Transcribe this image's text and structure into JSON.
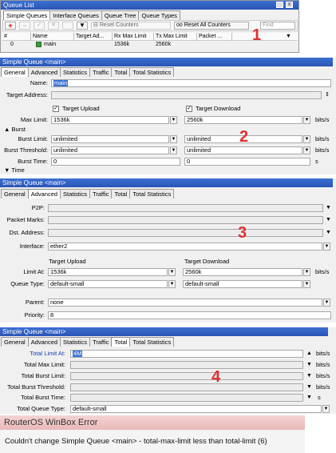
{
  "queue_list": {
    "title": "Queue List",
    "tabs": [
      "Simple Queues",
      "Interface Queues",
      "Queue Tree",
      "Queue Types"
    ],
    "toolbar": {
      "reset_counters": "Reset Counters",
      "reset_all_counters": "Reset All Counters",
      "find_placeholder": "Find"
    },
    "columns": [
      "#",
      "Name",
      "Target Ad...",
      "Rx Max Limit",
      "Tx Max Limit",
      "Packet ..."
    ],
    "rows": [
      {
        "num": "0",
        "name": "main",
        "target": "",
        "rx": "1536k",
        "tx": "2560k",
        "packet": ""
      }
    ],
    "annotation": "1"
  },
  "general_window": {
    "title": "Simple Queue <main>",
    "tabs": [
      "General",
      "Advanced",
      "Statistics",
      "Traffic",
      "Total",
      "Total Statistics"
    ],
    "name_label": "Name:",
    "name_value": "main",
    "target_address_label": "Target Address:",
    "target_upload_label": "Target Upload",
    "target_download_label": "Target Download",
    "max_limit_label": "Max Limit:",
    "max_limit_up": "1536k",
    "max_limit_down": "2560k",
    "burst_section": "Burst",
    "burst_limit_label": "Burst Limit:",
    "burst_limit_up": "unlimited",
    "burst_limit_down": "unlimited",
    "burst_threshold_label": "Burst Threshold:",
    "burst_threshold_up": "unlimited",
    "burst_threshold_down": "unlimited",
    "burst_time_label": "Burst Time:",
    "burst_time_up": "0",
    "burst_time_down": "0",
    "time_section": "Time",
    "unit_bits": "bits/s",
    "unit_s": "s",
    "annotation": "2"
  },
  "advanced_window": {
    "title": "Simple Queue <main>",
    "tabs": [
      "General",
      "Advanced",
      "Statistics",
      "Traffic",
      "Total",
      "Total Statistics"
    ],
    "p2p_label": "P2P:",
    "packet_marks_label": "Packet Marks:",
    "dst_address_label": "Dst. Address:",
    "interface_label": "Interface:",
    "interface_value": "ether2",
    "target_upload_label": "Target Upload",
    "target_download_label": "Target Download",
    "limit_at_label": "Limit At:",
    "limit_at_up": "1536k",
    "limit_at_down": "2560k",
    "queue_type_label": "Queue Type:",
    "queue_type_up": "default-small",
    "queue_type_down": "default-small",
    "parent_label": "Parent:",
    "parent_value": "none",
    "priority_label": "Priority:",
    "priority_value": "8",
    "unit_bits": "bits/s",
    "annotation": "3"
  },
  "total_window": {
    "title": "Simple Queue <main>",
    "tabs": [
      "General",
      "Advanced",
      "Statistics",
      "Traffic",
      "Total",
      "Total Statistics"
    ],
    "total_limit_at_label": "Total Limit At:",
    "total_limit_at_value": "4M",
    "total_max_limit_label": "Total Max Limit:",
    "total_burst_limit_label": "Total Burst Limit:",
    "total_burst_threshold_label": "Total Burst Threshold:",
    "total_burst_time_label": "Total Burst Time:",
    "total_queue_type_label": "Total Queue Type:",
    "total_queue_type_value": "default-small",
    "unit_bits": "bits/s",
    "unit_s": "s",
    "annotation": "4"
  },
  "error": {
    "title": "RouterOS WinBox Error",
    "message": "Couldn't change Simple Queue <main> - total-max-limit less than total-limit (6)"
  },
  "colors": {
    "titlebar": "#2f5fc4",
    "annotation": "#e03030",
    "error_title_bg": "#f0c8c8"
  }
}
